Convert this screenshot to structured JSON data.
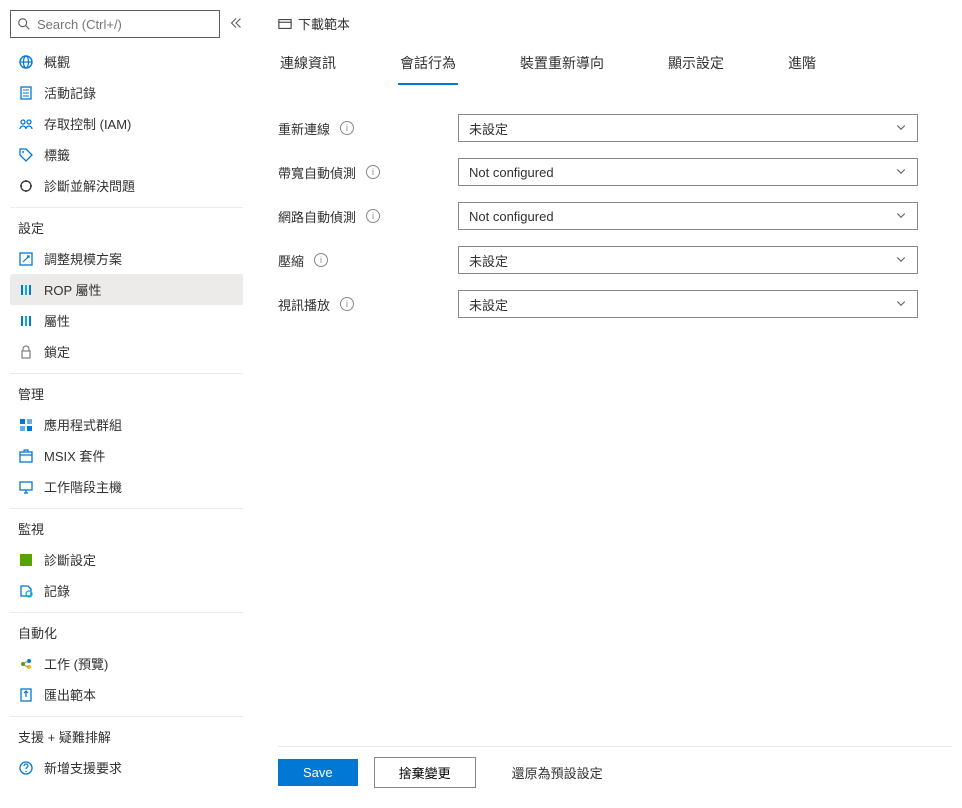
{
  "search": {
    "placeholder": "Search (Ctrl+/)"
  },
  "sidebar": {
    "items": [
      {
        "label": "概觀",
        "icon": "globe",
        "color": "#0078d4"
      },
      {
        "label": "活動記錄",
        "icon": "log",
        "color": "#0078d4"
      },
      {
        "label": "存取控制 (IAM)",
        "icon": "iam",
        "color": "#0078d4"
      },
      {
        "label": "標籤",
        "icon": "tag",
        "color": "#0078d4"
      },
      {
        "label": "診斷並解決問題",
        "icon": "diagnose",
        "color": "#323130"
      }
    ],
    "sections": [
      {
        "title": "設定",
        "items": [
          {
            "label": "調整規模方案",
            "icon": "scale",
            "color": "#0078d4"
          },
          {
            "label": "ROP 屬性",
            "icon": "props",
            "color": "#0078d4",
            "active": true
          },
          {
            "label": "屬性",
            "icon": "props",
            "color": "#0078d4"
          },
          {
            "label": "鎖定",
            "icon": "lock",
            "color": "#8a8886"
          }
        ]
      },
      {
        "title": "管理",
        "items": [
          {
            "label": "應用程式群組",
            "icon": "appgroup",
            "color": "#0078d4"
          },
          {
            "label": "MSIX 套件",
            "icon": "msix",
            "color": "#0078d4"
          },
          {
            "label": "工作階段主機",
            "icon": "host",
            "color": "#0078d4"
          }
        ]
      },
      {
        "title": "監視",
        "items": [
          {
            "label": "診斷設定",
            "icon": "diagsettings",
            "color": "#57a300"
          },
          {
            "label": "記錄",
            "icon": "logs",
            "color": "#0078d4"
          }
        ]
      },
      {
        "title": "自動化",
        "items": [
          {
            "label": "工作 (預覽)",
            "icon": "tasks",
            "color": "#0078d4"
          },
          {
            "label": "匯出範本",
            "icon": "export",
            "color": "#0078d4"
          }
        ]
      },
      {
        "title": "支援 + 疑難排解",
        "items": [
          {
            "label": "新增支援要求",
            "icon": "support",
            "color": "#0078d4"
          }
        ]
      }
    ]
  },
  "main": {
    "download_template": "下載範本",
    "tabs": [
      {
        "label": "連線資訊"
      },
      {
        "label": "會話行為",
        "active": true
      },
      {
        "label": "裝置重新導向"
      },
      {
        "label": "顯示設定"
      },
      {
        "label": "進階"
      }
    ],
    "rows": [
      {
        "label": "重新連線",
        "value": "未設定"
      },
      {
        "label": "帶寬自動偵測",
        "value": "Not configured"
      },
      {
        "label": "網路自動偵測",
        "value": "Not configured"
      },
      {
        "label": "壓縮",
        "value": "未設定"
      },
      {
        "label": "視訊播放",
        "value": "未設定"
      }
    ]
  },
  "footer": {
    "save": "Save",
    "discard": "捨棄變更",
    "reset": "還原為預設設定"
  }
}
